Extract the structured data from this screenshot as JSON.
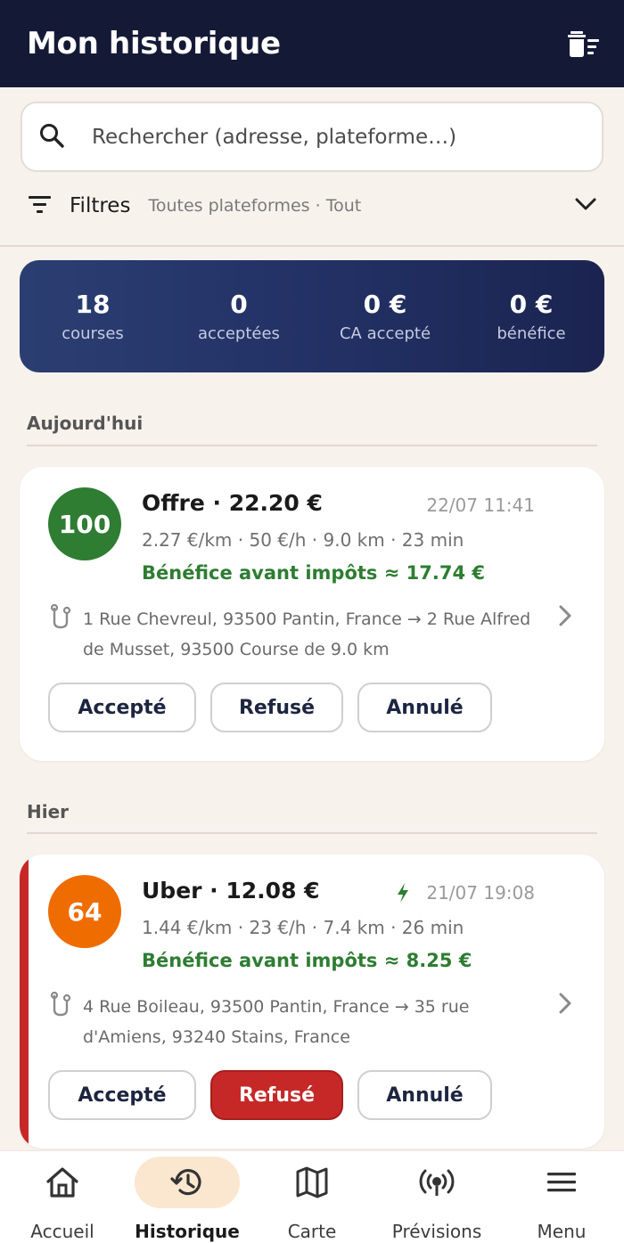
{
  "header": {
    "title": "Mon historique",
    "delete_icon": "delete-sweep-icon"
  },
  "search": {
    "placeholder": "Rechercher (adresse, plateforme…)",
    "value": ""
  },
  "filters": {
    "label": "Filtres",
    "summary": "Toutes plateformes · Tout"
  },
  "stats": [
    {
      "value": "18",
      "label": "courses"
    },
    {
      "value": "0",
      "label": "acceptées"
    },
    {
      "value": "0 €",
      "label": "CA accepté"
    },
    {
      "value": "0 €",
      "label": "bénéfice"
    }
  ],
  "sections": [
    {
      "title": "Aujourd'hui",
      "rides": [
        {
          "score": "100",
          "score_color": "#2e7d32",
          "title": "Offre · 22.20 €",
          "date": "22/07 11:41",
          "metrics": "2.27 €/km · 50 €/h · 9.0 km · 23 min",
          "profit": "Bénéfice avant impôts ≈ 17.74 €",
          "route": "1 Rue Chevreul, 93500 Pantin, France  →  2 Rue Alfred de Musset, 93500 Course de 9.0 km",
          "status": "none",
          "actions": {
            "accept": "Accepté",
            "refuse": "Refusé",
            "cancel": "Annulé"
          }
        }
      ]
    },
    {
      "title": "Hier",
      "rides": [
        {
          "score": "64",
          "score_color": "#ef6c00",
          "title": "Uber · 12.08 €",
          "date": "21/07 19:08",
          "boosted": true,
          "metrics": "1.44 €/km · 23 €/h · 7.4 km · 26 min",
          "profit": "Bénéfice avant impôts ≈ 8.25 €",
          "route": "4 Rue Boileau, 93500 Pantin, France  →  35 rue d'Amiens, 93240 Stains, France",
          "status": "refused",
          "actions": {
            "accept": "Accepté",
            "refuse": "Refusé",
            "cancel": "Annulé"
          }
        }
      ]
    }
  ],
  "bottom_nav": [
    {
      "label": "Accueil",
      "icon": "home-icon"
    },
    {
      "label": "Historique",
      "icon": "history-icon",
      "active": true
    },
    {
      "label": "Carte",
      "icon": "map-icon"
    },
    {
      "label": "Prévisions",
      "icon": "broadcast-icon"
    },
    {
      "label": "Menu",
      "icon": "menu-icon"
    }
  ],
  "colors": {
    "header_bg": "#141a36",
    "background": "#f7f2ec",
    "profit_green": "#2e7d32",
    "refused_red": "#c62828",
    "nav_active_bg": "#fbe6cf"
  }
}
